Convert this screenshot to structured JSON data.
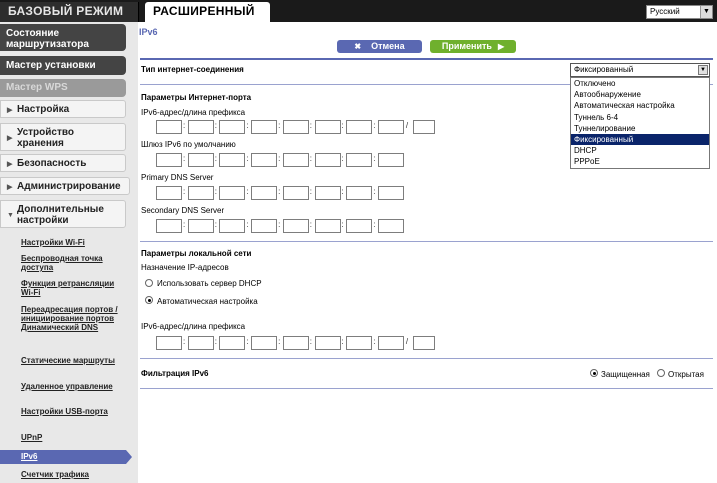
{
  "tabs": {
    "basic": "БАЗОВЫЙ РЕЖИМ",
    "advanced": "РАСШИРЕННЫЙ"
  },
  "language": {
    "selected": "Русский"
  },
  "sidebar": {
    "status": "Состояние маршрутизатора",
    "setup_wizard": "Мастер установки",
    "wps_wizard": "Мастер WPS",
    "sections": [
      {
        "label": "Настройка"
      },
      {
        "label": "Устройство хранения"
      },
      {
        "label": "Безопасность"
      },
      {
        "label": "Администрирование"
      },
      {
        "label": "Дополнительные настройки"
      }
    ],
    "subitems": [
      {
        "label": "Настройки Wi-Fi"
      },
      {
        "label": "Беспроводная точка доступа"
      },
      {
        "label": "Функция ретрансляции Wi-Fi"
      },
      {
        "label": "Переадресация портов / инициирование портов Динамический DNS"
      },
      {
        "label": "Статические маршруты"
      },
      {
        "label": "Удаленное управление"
      },
      {
        "label": "Настройки USB-порта"
      },
      {
        "label": "UPnP"
      },
      {
        "label": "IPv6"
      },
      {
        "label": "Счетчик трафика"
      }
    ]
  },
  "page": {
    "title": "IPv6",
    "cancel": "Отмена",
    "apply": "Применить",
    "connection_type_label": "Тип интернет-соединения",
    "connection_type_value": "Фиксированный",
    "connection_options": [
      "Отключено",
      "Автообнаружение",
      "Автоматическая настройка",
      "Туннель 6-4",
      "Туннелирование",
      "Фиксированный",
      "DHCP",
      "PPPoE"
    ],
    "internet_port": {
      "heading": "Параметры Интернет-порта",
      "prefix_label": "IPv6-адрес/длина префикса",
      "gateway_label": "Шлюз IPv6 по умолчанию",
      "primary_dns": "Primary DNS Server",
      "secondary_dns": "Secondary DNS Server"
    },
    "lan": {
      "heading": "Параметры локальной сети",
      "assign_label": "Назначение IP-адресов",
      "dhcp_option": "Использовать сервер DHCP",
      "auto_option": "Автоматическая настройка",
      "prefix_label": "IPv6-адрес/длина префикса"
    },
    "filtering": {
      "label": "Фильтрация IPv6",
      "secured": "Защищенная",
      "open": "Открытая"
    }
  }
}
